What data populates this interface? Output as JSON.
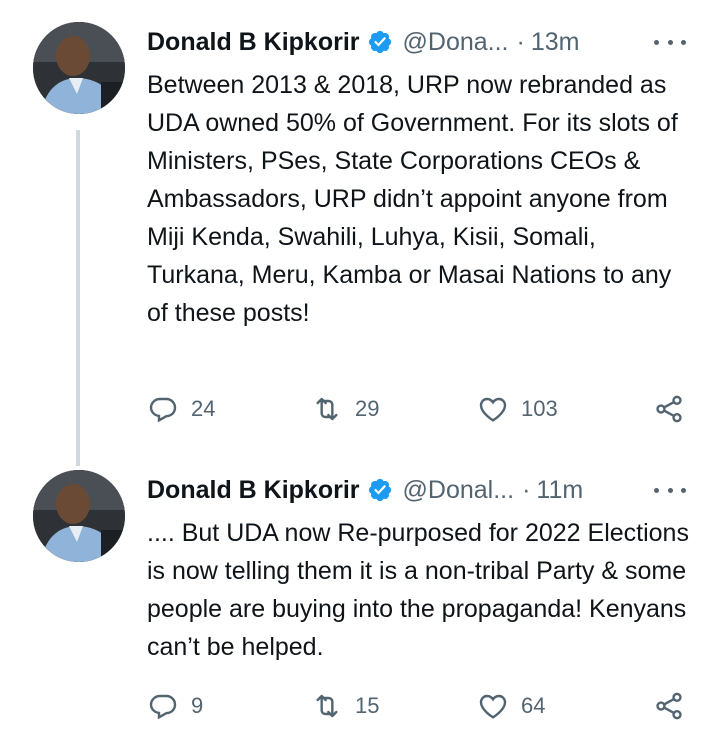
{
  "tweets": [
    {
      "author_name": "Donald B Kipkorir",
      "handle": "@Dona...",
      "separator": "·",
      "time": "13m",
      "text": "Between 2013 & 2018, URP now rebranded as UDA owned 50% of Government. For its slots of Ministers, PSes, State Corporations CEOs & Ambassadors, URP didn’t appoint anyone from Miji Kenda, Swahili, Luhya, Kisii, Somali, Turkana, Meru, Kamba or Masai Nations to any of these posts!",
      "replies": "24",
      "retweets": "29",
      "likes": "103"
    },
    {
      "author_name": "Donald B Kipkorir",
      "handle": "@Donal...",
      "separator": "·",
      "time": "11m",
      "text": ".... But UDA now Re-purposed for 2022 Elections is now telling them it is a non-tribal Party & some people are buying into the propaganda! Kenyans can’t be helped.",
      "replies": "9",
      "retweets": "15",
      "likes": "64"
    }
  ],
  "icons": {
    "verified": "verified-badge-icon",
    "more": "more-options-icon",
    "reply": "reply-icon",
    "retweet": "retweet-icon",
    "like": "heart-icon",
    "share": "share-icon"
  },
  "colors": {
    "verified_blue": "#1d9bf0",
    "secondary_text": "#536471",
    "thread_line": "#cfd9de"
  }
}
